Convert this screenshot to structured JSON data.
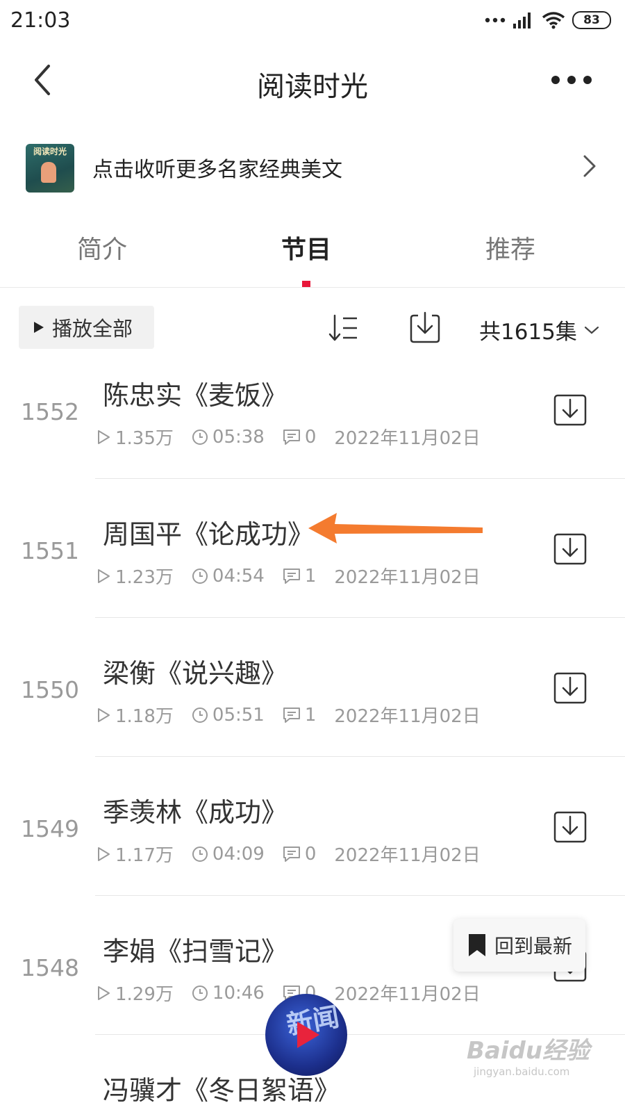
{
  "status": {
    "time": "21:03",
    "battery": "83"
  },
  "header": {
    "title": "阅读时光"
  },
  "promo": {
    "cover_text": "阅读时光",
    "text": "点击收听更多名家经典美文"
  },
  "tabs": [
    {
      "label": "简介",
      "active": false
    },
    {
      "label": "节目",
      "active": true
    },
    {
      "label": "推荐",
      "active": false
    }
  ],
  "toolbar": {
    "play_all": "播放全部",
    "count": "共1615集"
  },
  "episodes": [
    {
      "num": "1552",
      "title": "陈忠实《麦饭》",
      "plays": "1.35万",
      "duration": "05:38",
      "comments": "0",
      "date": "2022年11月02日"
    },
    {
      "num": "1551",
      "title": "周国平《论成功》",
      "plays": "1.23万",
      "duration": "04:54",
      "comments": "1",
      "date": "2022年11月02日"
    },
    {
      "num": "1550",
      "title": "梁衡《说兴趣》",
      "plays": "1.18万",
      "duration": "05:51",
      "comments": "1",
      "date": "2022年11月02日"
    },
    {
      "num": "1549",
      "title": "季羡林《成功》",
      "plays": "1.17万",
      "duration": "04:09",
      "comments": "0",
      "date": "2022年11月02日"
    },
    {
      "num": "1548",
      "title": "李娟《扫雪记》",
      "plays": "1.29万",
      "duration": "10:46",
      "comments": "0",
      "date": "2022年11月02日"
    },
    {
      "num": "",
      "title": "冯骥才《冬日絮语》",
      "plays": "",
      "duration": "",
      "comments": "",
      "date": ""
    }
  ],
  "floating": {
    "back_latest": "回到最新",
    "player_text": "新闻"
  },
  "watermark": {
    "main": "Baidu经验",
    "sub": "jingyan.baidu.com"
  },
  "colors": {
    "accent": "#e8173a",
    "annotation_arrow": "#f47b2f"
  }
}
